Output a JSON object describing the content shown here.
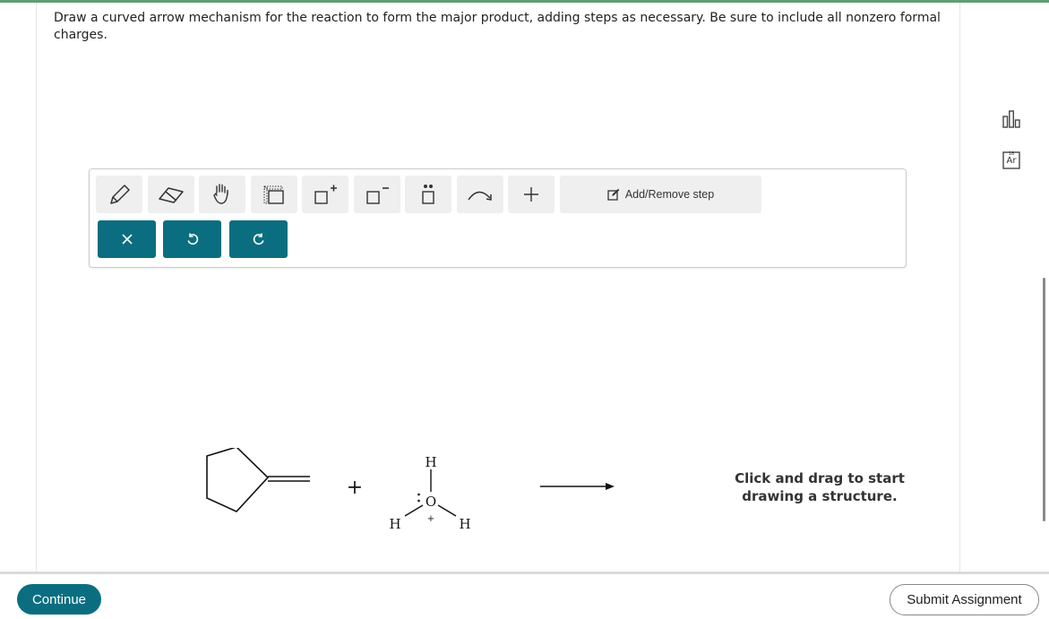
{
  "question": {
    "text": "Draw a curved arrow mechanism for the reaction to form the major product, adding steps as necessary. Be sure to include all nonzero formal charges."
  },
  "side_tools": [
    {
      "icon": "bar-chart-icon"
    },
    {
      "icon": "periodic-table-icon",
      "label": "Ar",
      "number": "18"
    }
  ],
  "toolbar": {
    "tools": [
      {
        "icon": "pencil-icon"
      },
      {
        "icon": "eraser-icon"
      },
      {
        "icon": "hand-icon"
      },
      {
        "icon": "select-icon"
      },
      {
        "icon": "positive-charge-icon"
      },
      {
        "icon": "negative-charge-icon"
      },
      {
        "icon": "lone-pair-icon"
      },
      {
        "icon": "curved-arrow-icon"
      },
      {
        "icon": "plus-icon"
      }
    ],
    "add_remove_label": "Add/Remove step",
    "actions": [
      {
        "icon": "close-icon"
      },
      {
        "icon": "undo-icon"
      },
      {
        "icon": "redo-icon"
      }
    ]
  },
  "reaction": {
    "plus_sign": "+",
    "hydronium": {
      "h_top": "H",
      "o": "O",
      "h_left": "H",
      "h_right": "H",
      "charge": "+"
    }
  },
  "hint": {
    "line1": "Click and drag to start",
    "line2": "drawing a structure."
  },
  "footer": {
    "continue_label": "Continue",
    "submit_label": "Submit Assignment"
  },
  "colors": {
    "accent": "#0b6e80",
    "top_rule": "#5ea074",
    "button_bg": "#efefef"
  }
}
